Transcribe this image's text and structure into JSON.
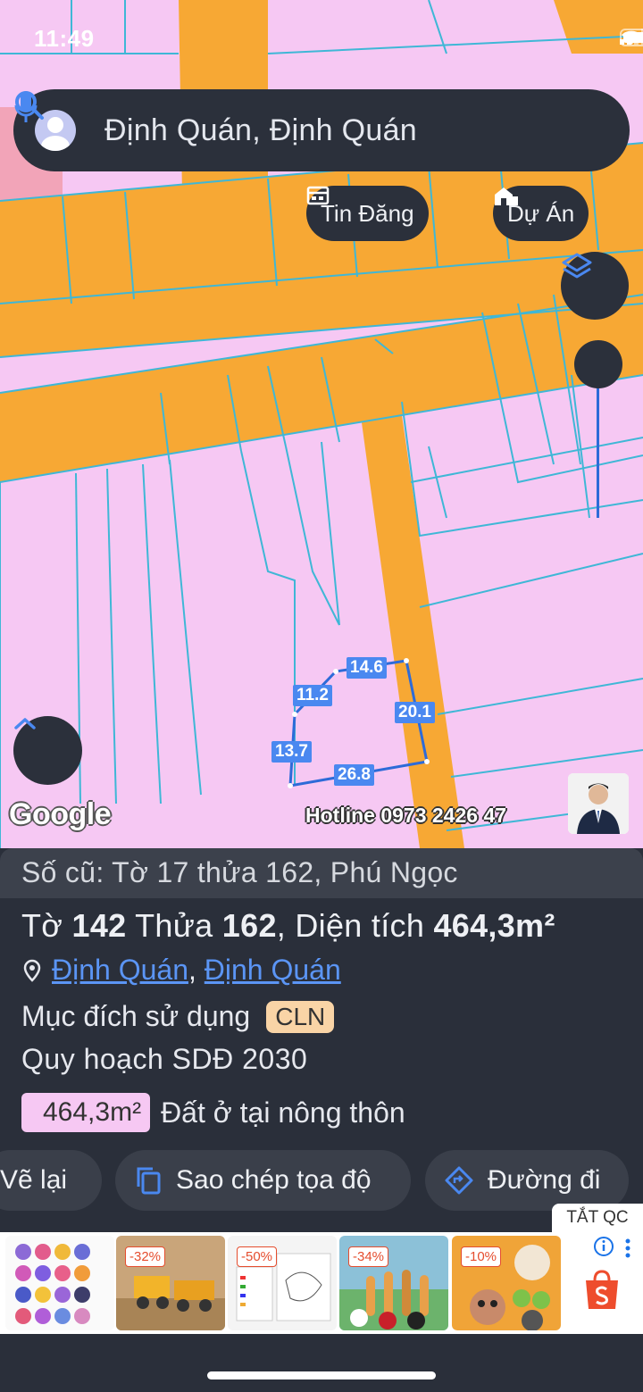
{
  "status": {
    "time": "11:49"
  },
  "search": {
    "text": "Định Quán, Định Quán"
  },
  "chips": {
    "listings": "Tin Đăng",
    "projects": "Dự Án"
  },
  "map": {
    "measurements": [
      "14.6",
      "11.2",
      "20.1",
      "13.7",
      "26.8"
    ],
    "google_logo": "Google",
    "hotline": "Hotline 0973 2426 47"
  },
  "parcel": {
    "old_number": "Số cũ: Tờ 17 thửa 162, Phú Ngọc",
    "sheet_label": "Tờ",
    "sheet": "142",
    "plot_label": "Thửa",
    "plot": "162",
    "area_label": ", Diện tích",
    "area": "464,3m²",
    "location_1": "Định Quán",
    "location_sep": ",",
    "location_2": "Định Quán",
    "usage_label": "Mục đích sử dụng",
    "usage_code": "CLN",
    "plan_label": "Quy hoạch SDĐ 2030",
    "plan_area": "464,3m²",
    "plan_type": "Đất ở tại nông thôn"
  },
  "actions": {
    "redraw": "Vẽ lại",
    "copy_coords": "Sao chép tọa độ",
    "directions": "Đường đi"
  },
  "ads": {
    "close_label": "TẮT QC",
    "discounts": [
      "-32%",
      "-50%",
      "-34%",
      "-10%"
    ]
  },
  "colors": {
    "map_land": "#f6c8f3",
    "road": "#f7a834",
    "parcel_line": "#3fb7d6",
    "panel": "#2a2f3a",
    "accent": "#4a88f0"
  }
}
